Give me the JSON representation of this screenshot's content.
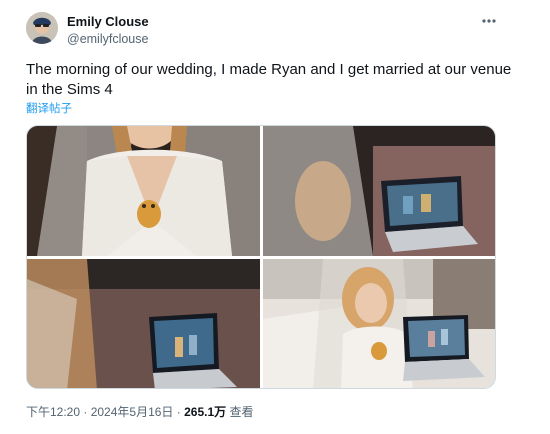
{
  "author": {
    "name": "Emily Clouse",
    "handle": "@emilyfclouse"
  },
  "tweet": {
    "text": "The morning of our wedding, I made Ryan and I get married at our venue in the Sims 4",
    "translate_label": "翻译帖子"
  },
  "meta": {
    "time": "下午12:20",
    "separator": " · ",
    "date": "2024年5月16日",
    "views_count": "265.1万",
    "views_label": " 查看"
  },
  "icons": {
    "more": "more-horizontal-icon"
  },
  "colors": {
    "text_primary": "#0f1419",
    "text_secondary": "#536471",
    "link": "#1d9bf0"
  }
}
